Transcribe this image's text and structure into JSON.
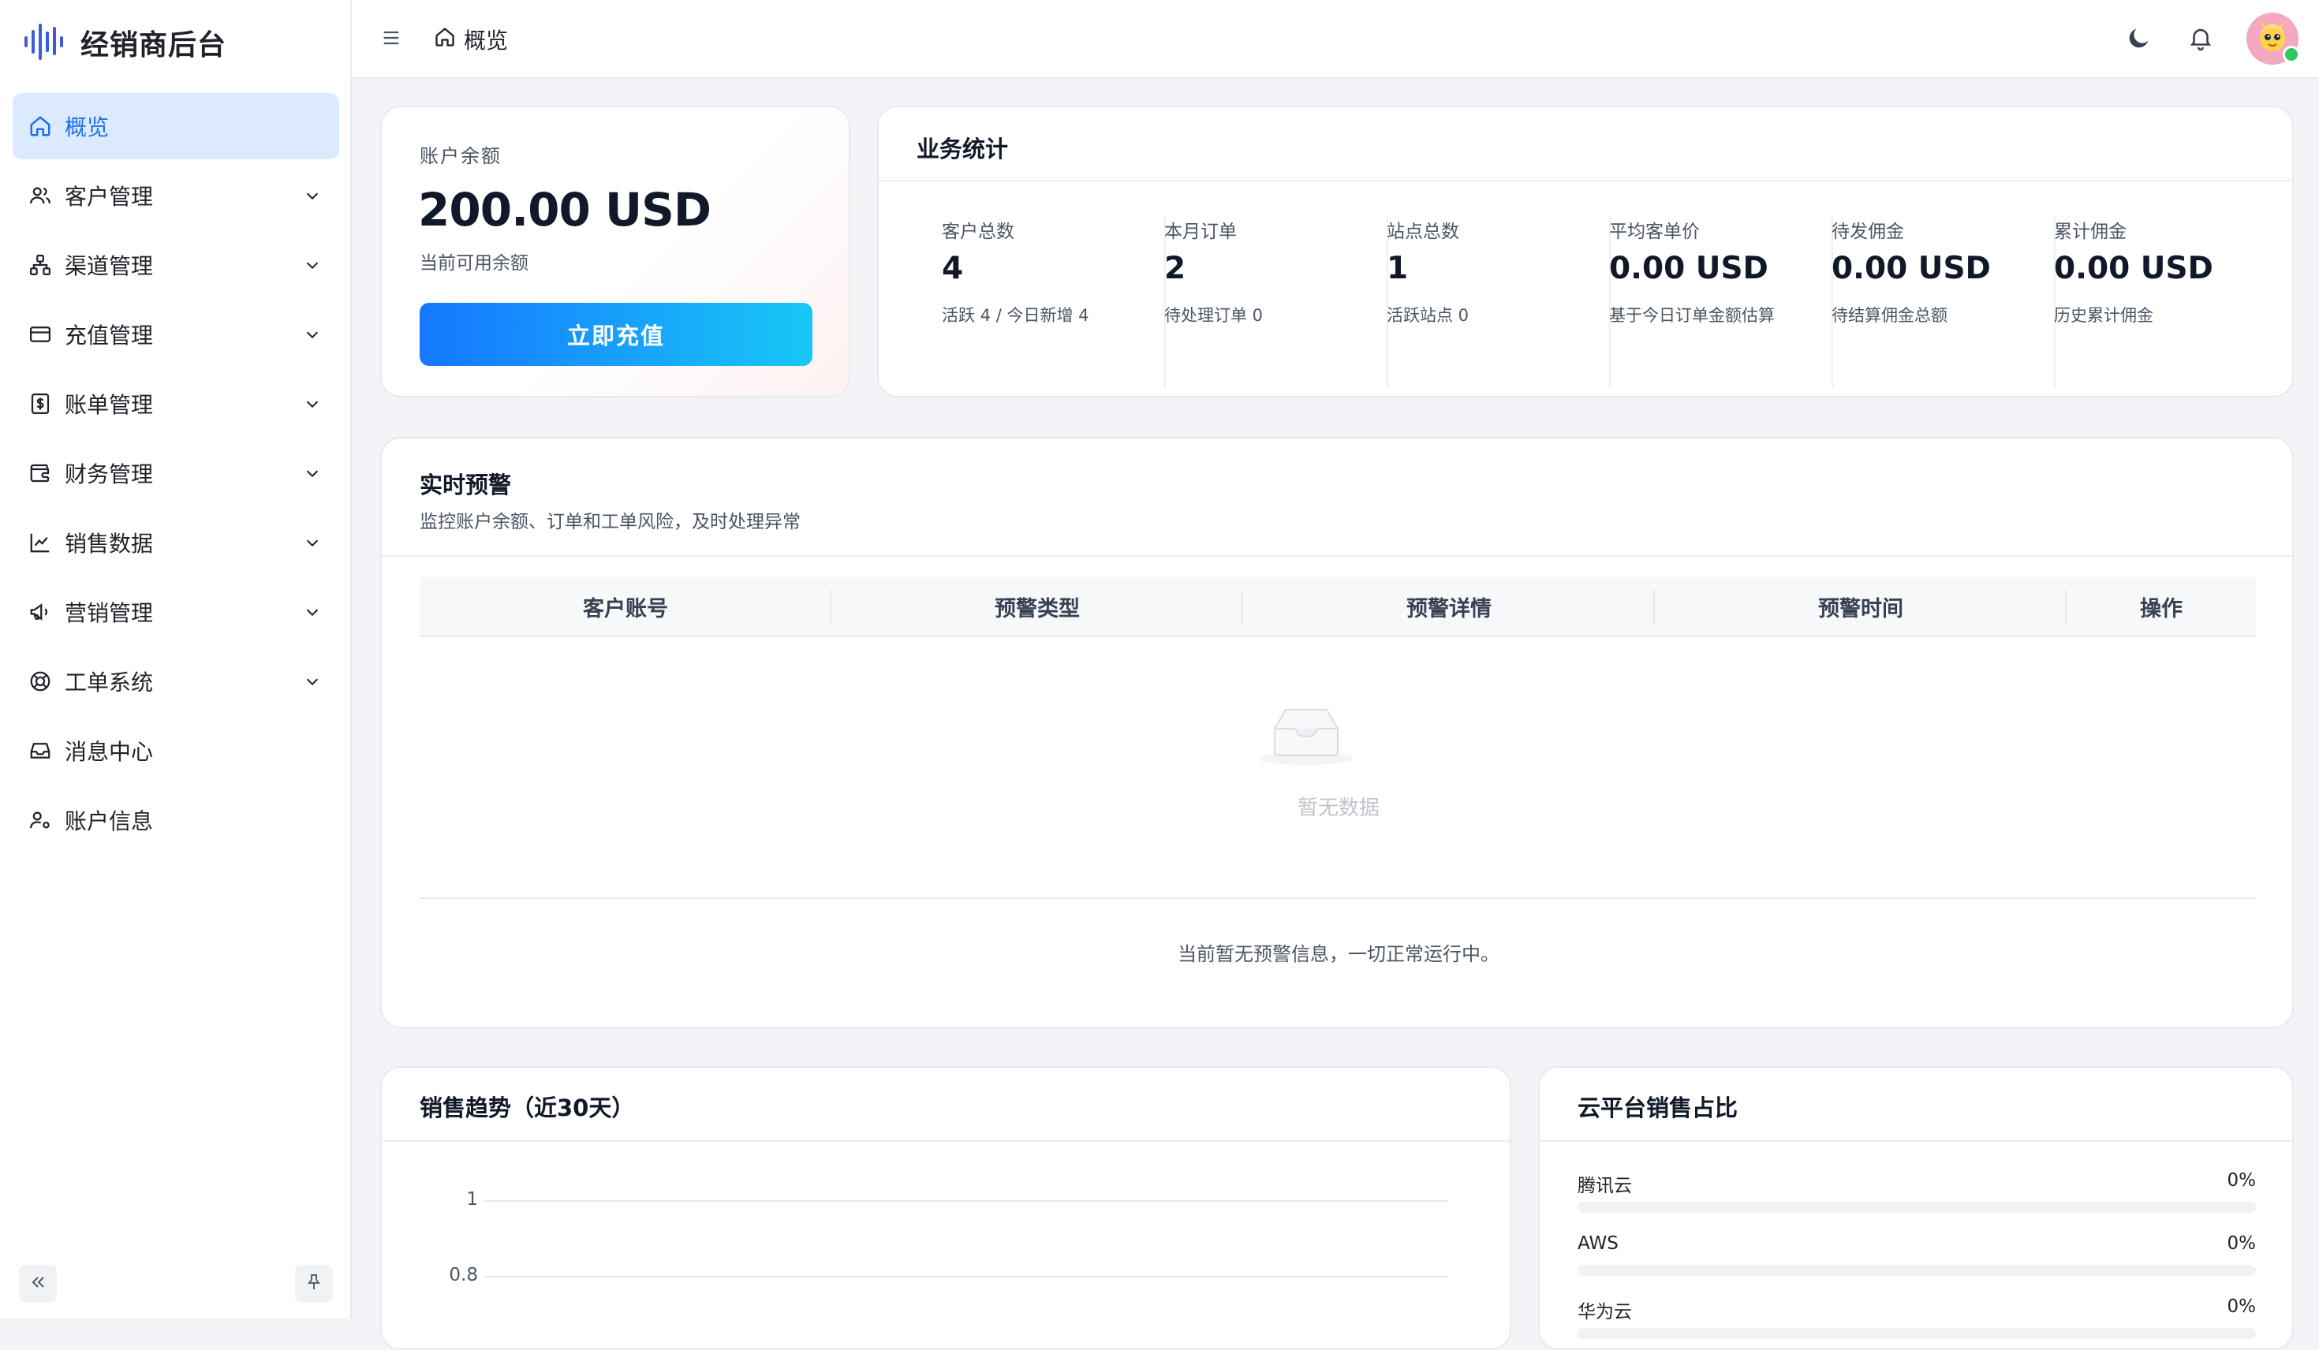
{
  "app": {
    "title": "经销商后台"
  },
  "sidebar": {
    "items": [
      {
        "label": "概览",
        "icon": "home-icon",
        "active": true,
        "expandable": false
      },
      {
        "label": "客户管理",
        "icon": "users-icon",
        "active": false,
        "expandable": true
      },
      {
        "label": "渠道管理",
        "icon": "channel-icon",
        "active": false,
        "expandable": true
      },
      {
        "label": "充值管理",
        "icon": "card-icon",
        "active": false,
        "expandable": true
      },
      {
        "label": "账单管理",
        "icon": "bill-icon",
        "active": false,
        "expandable": true
      },
      {
        "label": "财务管理",
        "icon": "wallet-icon",
        "active": false,
        "expandable": true
      },
      {
        "label": "销售数据",
        "icon": "chart-line-icon",
        "active": false,
        "expandable": true
      },
      {
        "label": "营销管理",
        "icon": "megaphone-icon",
        "active": false,
        "expandable": true
      },
      {
        "label": "工单系统",
        "icon": "lifebuoy-icon",
        "active": false,
        "expandable": true
      },
      {
        "label": "消息中心",
        "icon": "inbox-icon",
        "active": false,
        "expandable": false
      },
      {
        "label": "账户信息",
        "icon": "user-gear-icon",
        "active": false,
        "expandable": false
      }
    ]
  },
  "header": {
    "breadcrumb": "概览"
  },
  "balance": {
    "label": "账户余额",
    "value": "200.00 USD",
    "sub": "当前可用余额",
    "button": "立即充值"
  },
  "stats": {
    "title": "业务统计",
    "items": [
      {
        "label": "客户总数",
        "value": "4",
        "sub": "活跃 4 / 今日新增 4"
      },
      {
        "label": "本月订单",
        "value": "2",
        "sub": "待处理订单 0"
      },
      {
        "label": "站点总数",
        "value": "1",
        "sub": "活跃站点 0"
      },
      {
        "label": "平均客单价",
        "value": "0.00 USD",
        "sub": "基于今日订单金额估算"
      },
      {
        "label": "待发佣金",
        "value": "0.00 USD",
        "sub": "待结算佣金总额"
      },
      {
        "label": "累计佣金",
        "value": "0.00 USD",
        "sub": "历史累计佣金"
      }
    ]
  },
  "alerts": {
    "title": "实时预警",
    "subtitle": "监控账户余额、订单和工单风险，及时处理异常",
    "columns": [
      "客户账号",
      "预警类型",
      "预警详情",
      "预警时间",
      "操作"
    ],
    "empty": "暂无数据",
    "footer": "当前暂无预警信息，一切正常运行中。"
  },
  "trend": {
    "title": "销售趋势（近30天）"
  },
  "share": {
    "title": "云平台销售占比",
    "rows": [
      {
        "name": "腾讯云",
        "value": "0%",
        "fraction": 0
      },
      {
        "name": "AWS",
        "value": "0%",
        "fraction": 0
      },
      {
        "name": "华为云",
        "value": "0%",
        "fraction": 0
      }
    ]
  },
  "chart_data": {
    "type": "line",
    "title": "销售趋势（近30天）",
    "y_ticks": [
      "1",
      "0.8"
    ],
    "ylim": [
      0,
      1
    ],
    "series": [],
    "grid": true
  },
  "colors": {
    "accent": "#1677ff",
    "active_bg": "#dbeafe",
    "online": "#2fc760"
  }
}
